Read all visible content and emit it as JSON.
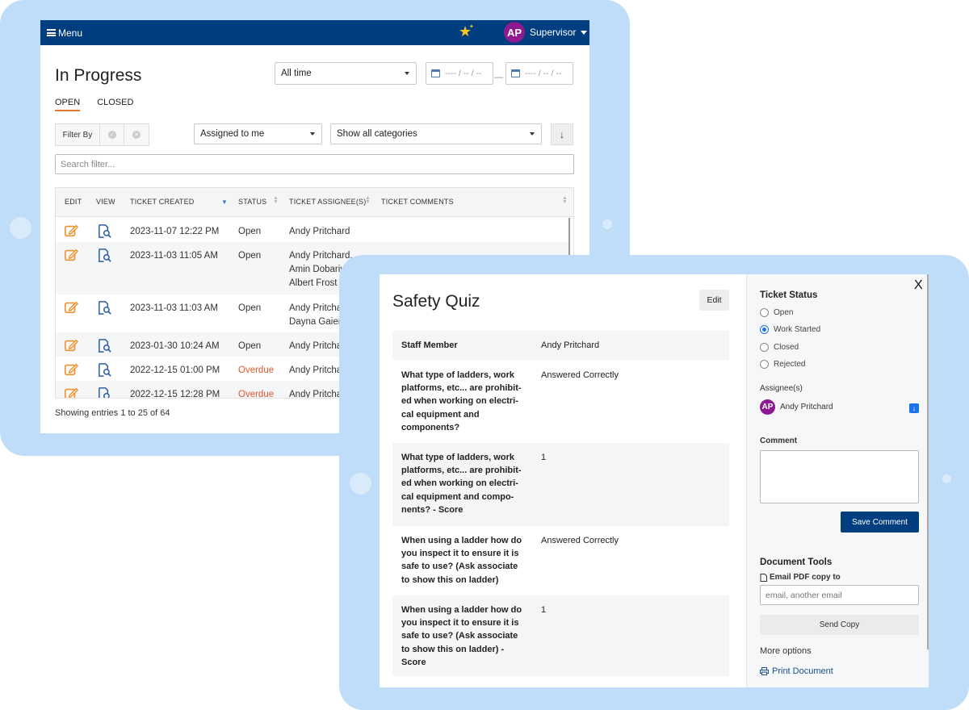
{
  "topbar": {
    "menu_label": "Menu",
    "avatar_initials": "AP",
    "user_role": "Supervisor"
  },
  "list_page": {
    "title": "In Progress",
    "time_filter": "All time",
    "date_from_placeholder": "---- / -- / --",
    "date_to_placeholder": "---- / -- / --",
    "date_separator": "—",
    "tabs": [
      "OPEN",
      "CLOSED"
    ],
    "filter_by_label": "Filter By",
    "assignee_filter": "Assigned to me",
    "category_filter": "Show all categories",
    "sort_label": "↓",
    "search_placeholder": "Search filter...",
    "columns": [
      "EDIT",
      "VIEW",
      "TICKET CREATED",
      "STATUS",
      "TICKET ASSIGNEE(S)",
      "TICKET COMMENTS"
    ],
    "rows": [
      {
        "created": "2023-11-07 12:22 PM",
        "status": "Open",
        "assignees": [
          "Andy Pritchard"
        ]
      },
      {
        "created": "2023-11-03 11:05 AM",
        "status": "Open",
        "assignees": [
          "Andy Pritchard,",
          "Amin Dobariya",
          "Albert Frost"
        ]
      },
      {
        "created": "2023-11-03 11:03 AM",
        "status": "Open",
        "assignees": [
          "Andy Pritchard",
          "Dayna Gaier"
        ]
      },
      {
        "created": "2023-01-30 10:24 AM",
        "status": "Open",
        "assignees": [
          "Andy Pritchard"
        ]
      },
      {
        "created": "2022-12-15 01:00 PM",
        "status": "Overdue",
        "assignees": [
          "Andy Pritchard"
        ]
      },
      {
        "created": "2022-12-15 12:28 PM",
        "status": "Overdue",
        "assignees": [
          "Andy Pritchard"
        ]
      }
    ],
    "footer": "Showing entries 1 to 25 of 64"
  },
  "quiz": {
    "title": "Safety Quiz",
    "edit_label": "Edit",
    "rows": [
      {
        "label": "Staff Member",
        "value": "Andy Pritchard"
      },
      {
        "label": "What type of ladders, work platforms, etc... are prohibit-ed when working on electri-cal equipment and components?",
        "value": "Answered Correctly"
      },
      {
        "label": "What type of ladders, work platforms, etc... are prohibit-ed when working on electri-cal equipment and compo-nents? - Score",
        "value": "1"
      },
      {
        "label": "When using a ladder how do you inspect it to ensure it is safe to use? (Ask associate to show this on ladder)",
        "value": "Answered Correctly"
      },
      {
        "label": "When using a ladder how do you inspect it to ensure it is safe to use? (Ask associate to show this on ladder) - Score",
        "value": "1"
      }
    ]
  },
  "sidebar": {
    "close_label": "X",
    "status_heading": "Ticket Status",
    "status_options": [
      "Open",
      "Work Started",
      "Closed",
      "Rejected"
    ],
    "selected_status": "Work Started",
    "assignees_heading": "Assignee(s)",
    "assignee_initials": "AP",
    "assignee_name": "Andy Pritchard",
    "comment_label": "Comment",
    "save_comment": "Save Comment",
    "doc_tools_heading": "Document Tools",
    "email_pdf_label": "Email PDF copy to",
    "email_placeholder": "email, another email",
    "send_copy": "Send Copy",
    "more_options": "More options",
    "print_document": "Print Document"
  }
}
